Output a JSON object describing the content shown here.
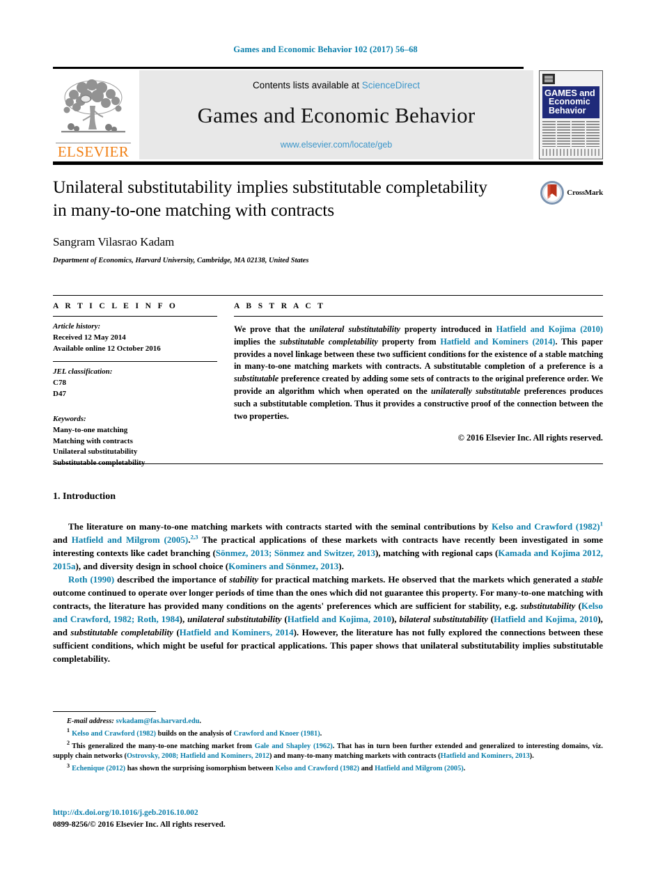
{
  "running_head": "Games and Economic Behavior 102 (2017) 56–68",
  "masthead": {
    "contents_prefix": "Contents lists available at ",
    "sciencedirect": "ScienceDirect",
    "journal_title": "Games and Economic Behavior",
    "journal_url": "www.elsevier.com/locate/geb",
    "publisher_wordmark": "ELSEVIER",
    "cover": {
      "line1": "GAMES and",
      "line2": "Economic",
      "line3": "Behavior"
    },
    "accent_link_color": "#3a95c9",
    "publisher_color": "#f07f13"
  },
  "article": {
    "title_line1": "Unilateral substitutability implies substitutable completability",
    "title_line2": "in many-to-one matching with contracts",
    "author": "Sangram Vilasrao Kadam",
    "affiliation": "Department of Economics, Harvard University, Cambridge, MA 02138, United States",
    "crossmark_label": "CrossMark"
  },
  "article_info": {
    "heading": "A R T I C L E    I N F O",
    "history_label": "Article history:",
    "history_lines": [
      "Received 12 May 2014",
      "Available online 12 October 2016"
    ],
    "jel_label": "JEL classification:",
    "jel_codes": [
      "C78",
      "D47"
    ],
    "keywords_label": "Keywords:",
    "keywords": [
      "Many-to-one matching",
      "Matching with contracts",
      "Unilateral substitutability",
      "Substitutable completability"
    ]
  },
  "abstract": {
    "heading": "A B S T R A C T",
    "copyright": "© 2016 Elsevier Inc. All rights reserved.",
    "segments": [
      {
        "t": "We prove that the ",
        "s": "plain"
      },
      {
        "t": "unilateral substitutability",
        "s": "italic"
      },
      {
        "t": " property introduced in ",
        "s": "plain"
      },
      {
        "t": "Hatfield and Kojima (2010)",
        "s": "link"
      },
      {
        "t": " implies the ",
        "s": "plain"
      },
      {
        "t": "substitutable completability",
        "s": "italic"
      },
      {
        "t": " property from ",
        "s": "plain"
      },
      {
        "t": "Hatfield and Kominers (2014)",
        "s": "link"
      },
      {
        "t": ". This paper provides a novel linkage between these two sufficient conditions for the existence of a stable matching in many-to-one matching markets with contracts. A substitutable completion of a preference is a ",
        "s": "plain"
      },
      {
        "t": "substitutable",
        "s": "italic"
      },
      {
        "t": " preference created by adding some sets of contracts to the original preference order. We provide an algorithm which when operated on the ",
        "s": "plain"
      },
      {
        "t": "unilaterally substitutable",
        "s": "italic"
      },
      {
        "t": " preferences produces such a substitutable completion. Thus it provides a constructive proof of the connection between the two properties.",
        "s": "plain"
      }
    ]
  },
  "body": {
    "section_heading": "1. Introduction",
    "paragraph1": [
      {
        "t": "The literature on many-to-one matching markets with contracts started with the seminal contributions by ",
        "s": "plain"
      },
      {
        "t": "Kelso and Crawford (1982)",
        "s": "link"
      },
      {
        "t": "1",
        "s": "sup"
      },
      {
        "t": " and ",
        "s": "plain"
      },
      {
        "t": "Hatfield and Milgrom (2005)",
        "s": "link"
      },
      {
        "t": ".",
        "s": "plain"
      },
      {
        "t": "2,3",
        "s": "sup"
      },
      {
        "t": " The practical applications of these markets with contracts have recently been investigated in some interesting contexts like cadet branching (",
        "s": "plain"
      },
      {
        "t": "Sönmez, 2013; Sönmez and Switzer, 2013",
        "s": "link"
      },
      {
        "t": "), matching with regional caps (",
        "s": "plain"
      },
      {
        "t": "Kamada and Kojima 2012, 2015a",
        "s": "link"
      },
      {
        "t": "), and diversity design in school choice (",
        "s": "plain"
      },
      {
        "t": "Kominers and Sönmez, 2013",
        "s": "link"
      },
      {
        "t": ").",
        "s": "plain"
      }
    ],
    "paragraph2": [
      {
        "t": "Roth (1990)",
        "s": "link"
      },
      {
        "t": " described the importance of ",
        "s": "plain"
      },
      {
        "t": "stability",
        "s": "italic"
      },
      {
        "t": " for practical matching markets. He observed that the markets which generated a ",
        "s": "plain"
      },
      {
        "t": "stable",
        "s": "italic"
      },
      {
        "t": " outcome continued to operate over longer periods of time than the ones which did not guarantee this property. For many-to-one matching with contracts, the literature has provided many conditions on the agents' preferences which are sufficient for stability, e.g. ",
        "s": "plain"
      },
      {
        "t": "substitutability",
        "s": "italic"
      },
      {
        "t": " (",
        "s": "plain"
      },
      {
        "t": "Kelso and Crawford, 1982; Roth, 1984",
        "s": "link"
      },
      {
        "t": "), ",
        "s": "plain"
      },
      {
        "t": "unilateral substitutability",
        "s": "italic"
      },
      {
        "t": " (",
        "s": "plain"
      },
      {
        "t": "Hatfield and Kojima, 2010",
        "s": "link"
      },
      {
        "t": "), ",
        "s": "plain"
      },
      {
        "t": "bilateral substitutability",
        "s": "italic"
      },
      {
        "t": " (",
        "s": "plain"
      },
      {
        "t": "Hatfield and Kojima, 2010",
        "s": "link"
      },
      {
        "t": "), and ",
        "s": "plain"
      },
      {
        "t": "substitutable completability",
        "s": "italic"
      },
      {
        "t": " (",
        "s": "plain"
      },
      {
        "t": "Hatfield and Kominers, 2014",
        "s": "link"
      },
      {
        "t": "). However, the literature has not fully explored the connections between these sufficient conditions, which might be useful for practical applications. This paper shows that unilateral substitutability implies substitutable completability.",
        "s": "plain"
      }
    ]
  },
  "footnotes": {
    "email_label": "E-mail address:",
    "email": "svkadam@fas.harvard.edu",
    "email_tail": ".",
    "items": [
      {
        "mark": "1",
        "segments": [
          {
            "t": "Kelso and Crawford (1982)",
            "s": "link"
          },
          {
            "t": " builds on the analysis of ",
            "s": "plain"
          },
          {
            "t": "Crawford and Knoer (1981)",
            "s": "link"
          },
          {
            "t": ".",
            "s": "plain"
          }
        ]
      },
      {
        "mark": "2",
        "segments": [
          {
            "t": "This generalized the many-to-one matching market from ",
            "s": "plain"
          },
          {
            "t": "Gale and Shapley (1962)",
            "s": "link"
          },
          {
            "t": ". That has in turn been further extended and generalized to interesting domains, viz. supply chain networks (",
            "s": "plain"
          },
          {
            "t": "Ostrovsky, 2008; Hatfield and Kominers, 2012",
            "s": "link"
          },
          {
            "t": ") and many-to-many matching markets with contracts (",
            "s": "plain"
          },
          {
            "t": "Hatfield and Kominers, 2013",
            "s": "link"
          },
          {
            "t": ").",
            "s": "plain"
          }
        ]
      },
      {
        "mark": "3",
        "segments": [
          {
            "t": "Echenique (2012)",
            "s": "link"
          },
          {
            "t": " has shown the surprising isomorphism between ",
            "s": "plain"
          },
          {
            "t": "Kelso and Crawford (1982)",
            "s": "link"
          },
          {
            "t": " and ",
            "s": "plain"
          },
          {
            "t": "Hatfield and Milgrom (2005)",
            "s": "link"
          },
          {
            "t": ".",
            "s": "plain"
          }
        ]
      }
    ]
  },
  "imprint": {
    "doi": "http://dx.doi.org/10.1016/j.geb.2016.10.002",
    "issn_line": "0899-8256/© 2016 Elsevier Inc. All rights reserved."
  },
  "colors": {
    "link": "#0b7fab",
    "sciencedirect": "#3a95c9",
    "elsevier_orange": "#f07f13",
    "cover_blue": "#1f2a7a",
    "crossmark_red": "#b9311a"
  }
}
